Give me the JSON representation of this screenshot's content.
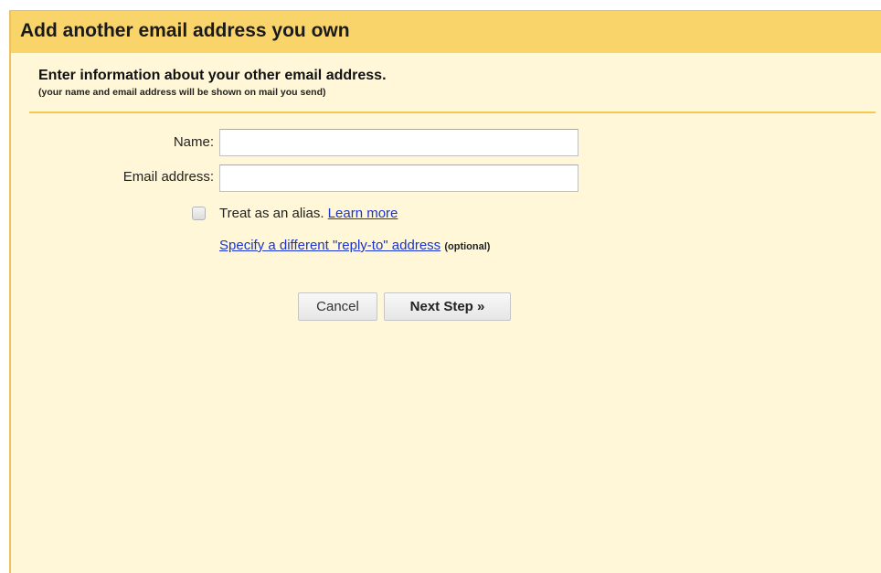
{
  "dialog": {
    "title": "Add another email address you own",
    "heading": "Enter information about your other email address.",
    "subheading": "(your name and email address will be shown on mail you send)"
  },
  "form": {
    "name_label": "Name:",
    "name_value": "",
    "email_label": "Email address:",
    "email_value": "",
    "alias_checked": false,
    "alias_label": "Treat as an alias.",
    "learn_more_link": "Learn more",
    "reply_to_link": "Specify a different \"reply-to\" address",
    "optional_label": "(optional)"
  },
  "buttons": {
    "cancel_label": "Cancel",
    "next_label": "Next Step »"
  },
  "colors": {
    "title_bar": "#f9d46b",
    "panel_background": "#fff7d7",
    "divider": "#f2c94c",
    "link": "#1a33cc"
  }
}
